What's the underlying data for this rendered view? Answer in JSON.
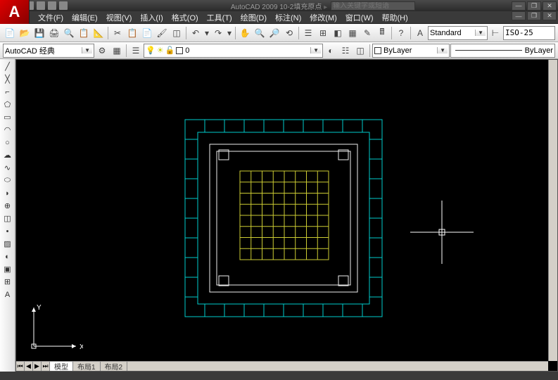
{
  "app": {
    "name": "AutoCAD 2009",
    "doc": "10-2填充原点",
    "search_placeholder": "输入关键字或短语"
  },
  "menu": {
    "file": "文件(F)",
    "edit": "编辑(E)",
    "view": "视图(V)",
    "insert": "插入(I)",
    "format": "格式(O)",
    "tools": "工具(T)",
    "draw": "绘图(D)",
    "dim": "标注(N)",
    "modify": "修改(M)",
    "window": "窗口(W)",
    "help": "帮助(H)"
  },
  "toolbar1": {
    "style_combo": "Standard",
    "dim_style": "ISO-25"
  },
  "toolbar2": {
    "workspace": "AutoCAD 经典",
    "layer": "0",
    "bylayer": "ByLayer",
    "bylayer2": "ByLayer"
  },
  "tabs": {
    "model": "模型",
    "layout1": "布局1",
    "layout2": "布局2"
  },
  "ucs": {
    "x": "X",
    "y": "Y"
  }
}
